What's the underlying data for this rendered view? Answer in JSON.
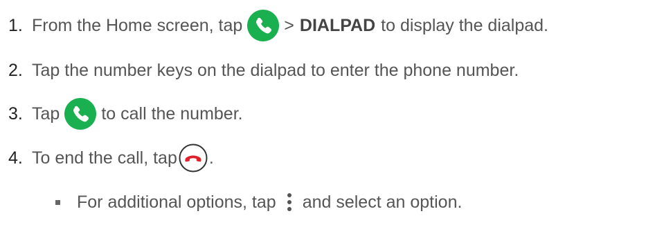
{
  "steps": [
    {
      "number": "1.",
      "text_before": "From the Home screen, tap",
      "separator": ">",
      "bold": "DIALPAD",
      "text_after": "to display the dialpad.",
      "icon": "phone-call-icon"
    },
    {
      "number": "2.",
      "text": "Tap the number keys on the dialpad to enter the phone number."
    },
    {
      "number": "3.",
      "text_before": "Tap",
      "text_after": "to call the number.",
      "icon": "phone-call-icon"
    },
    {
      "number": "4.",
      "text_before": "To end the call, tap",
      "text_after": ".",
      "icon": "end-call-icon"
    }
  ],
  "bullet": {
    "text_before": "For additional options, tap",
    "text_after": "and select an option.",
    "icon": "more-options-icon"
  },
  "colors": {
    "call_green": "#1bb04f",
    "end_red": "#e0202a",
    "text": "#555555"
  }
}
